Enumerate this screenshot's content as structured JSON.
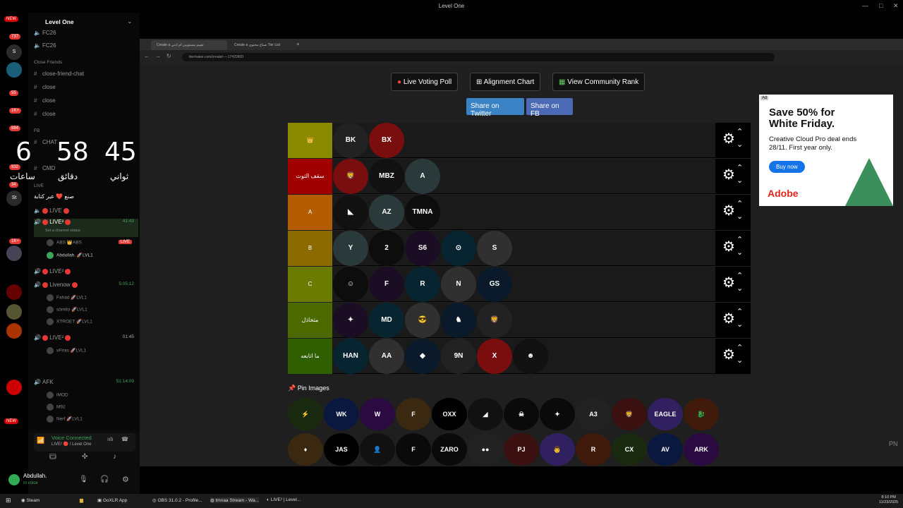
{
  "window": {
    "title": "Level One",
    "controls": [
      "—",
      "□",
      "✕"
    ]
  },
  "server_rail": {
    "badges": [
      "NEW",
      "737",
      "55",
      "1K+",
      "884",
      "932",
      "34",
      "1K+",
      "NEW"
    ],
    "labels": [
      "S",
      "St",
      "PN"
    ]
  },
  "sidebar": {
    "server_name": "Level One",
    "top_channels": [
      "FC26",
      "FC26"
    ],
    "close_friends_label": "Close Friends",
    "close_friends": [
      "close-friend-chat",
      "close",
      "close",
      "close"
    ],
    "fb_label": "FB",
    "fb_channels": [
      "CHAT",
      "",
      "CMD"
    ],
    "live_label": "LIVE",
    "voice_channels": [
      {
        "name": "LIVE",
        "time": ""
      },
      {
        "name": "LIVE²",
        "time": "41:43",
        "status": "Set a channel status"
      },
      {
        "name": "LIVE²",
        "time": ""
      },
      {
        "name": "Livenow",
        "time": "5:05:12"
      },
      {
        "name": "LIVE²",
        "time": "01:45"
      }
    ],
    "users_live2": [
      "ABS 👑ABS",
      "Abdullah. 🚀LVL1"
    ],
    "live_tag": "LIVE",
    "users_livenow": [
      "Fahad 🚀LVL1",
      "sömito 🚀LVL1",
      "XTROET 🚀LVL1"
    ],
    "users_live3": [
      "vFiras 🚀LVL1"
    ],
    "afk_name": "AFK",
    "afk_time": "51:14:09",
    "afk_users": [
      "iMOD",
      "M92",
      "Nerf 🚀LVL1"
    ],
    "status_text": "صنع ❤️ عبر كتابة"
  },
  "timer": {
    "hours": "6",
    "minutes": "58",
    "seconds": "45",
    "h_label": "ساعات",
    "m_label": "دقائق",
    "s_label": "ثواني"
  },
  "voice": {
    "connected": "Voice Connected",
    "channel": "LIVE² 🔴 / Level One",
    "user": "Abdullah.",
    "user_status": "In voice"
  },
  "browser": {
    "tabs": [
      "Create a تقييم مستويين ام ادني",
      "Create a صناع محتوى Tier List"
    ],
    "url": "tiermaker.com/create/----17420900"
  },
  "page": {
    "buttons": [
      "Live Voting Poll",
      "Alignment Chart",
      "View Community Rank"
    ],
    "share": [
      "Share on Twitter",
      "Share on FB"
    ],
    "tiers": [
      {
        "label": "👑",
        "color": "#8a8a00",
        "items": [
          "BK",
          "BX"
        ]
      },
      {
        "label": "سقف الثوث",
        "color": "#a00000",
        "items": [
          "🦁",
          "MBZ",
          "A"
        ]
      },
      {
        "label": "A",
        "color": "#b35d00",
        "items": [
          "◣",
          "AZ",
          "TMNA"
        ]
      },
      {
        "label": "B",
        "color": "#8b6a00",
        "items": [
          "Y",
          "2",
          "S6",
          "⊙",
          "S"
        ]
      },
      {
        "label": "C",
        "color": "#6b7b00",
        "items": [
          "☺",
          "F",
          "R",
          "N",
          "GS"
        ]
      },
      {
        "label": "متخاذل",
        "color": "#4d6a00",
        "items": [
          "✦",
          "MD",
          "😎",
          "♞",
          "🦁"
        ]
      },
      {
        "label": "ما اتابعه",
        "color": "#2e5e00",
        "items": [
          "HAN",
          "AA",
          "◆",
          "9N",
          "X",
          "☻"
        ]
      }
    ],
    "pin_label": "Pin Images",
    "pins_row1": [
      "⚡",
      "WK",
      "W",
      "F",
      "OXX",
      "◢",
      "☠",
      "✦",
      "A3",
      "🦁",
      "EAGLE",
      "🐉"
    ],
    "pins_row2": [
      "♦",
      "JAS",
      "👤",
      "F",
      "ZARO",
      "●●",
      "PJ",
      "👨",
      "R",
      "CX",
      "AV",
      "ARK"
    ],
    "ad": {
      "tag": "Ad",
      "headline": "Save 50% for White Friday.",
      "body": "Creative Cloud Pro deal ends 28/11. First year only.",
      "cta": "Buy now",
      "brand": "Adobe"
    }
  },
  "taskbar": {
    "items": [
      "Steam",
      "",
      "GoXLR App",
      "OBS 31.0.2 - Profile...",
      "tmnaa Stream - Wa...",
      "LIVE² | Level..."
    ],
    "time": "8:10 PM",
    "date": "11/23/2025"
  }
}
